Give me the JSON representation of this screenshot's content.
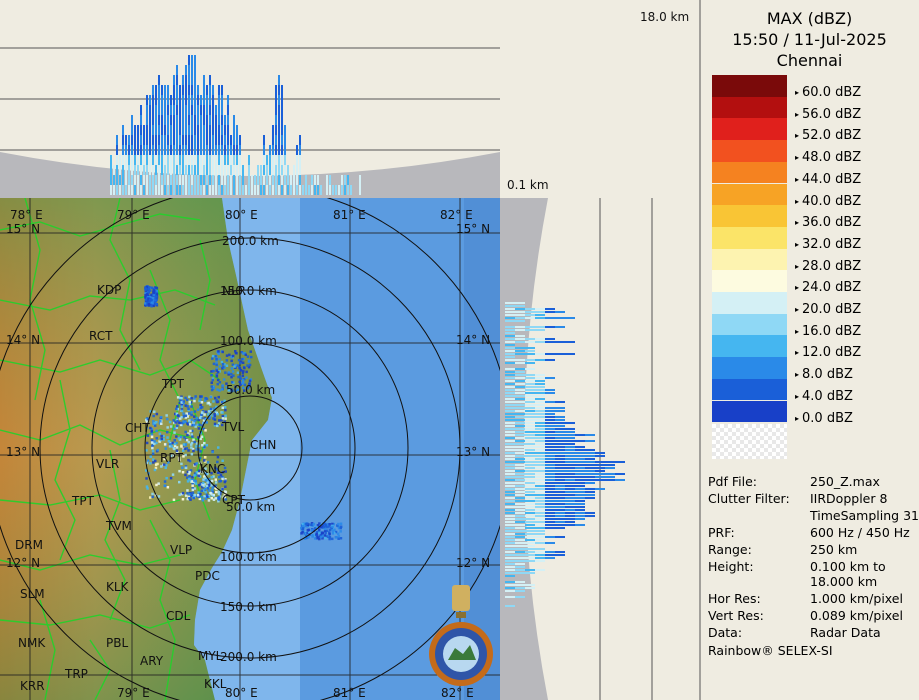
{
  "header": {
    "product": "MAX (dBZ)",
    "datetime": "15:50 / 11-Jul-2025",
    "station": "Chennai"
  },
  "profile_labels": {
    "top_height": "18.0 km",
    "side_height": "0.1 km"
  },
  "legend": [
    {
      "label": "60.0 dBZ",
      "color": "#7a0a0a"
    },
    {
      "label": "56.0 dBZ",
      "color": "#b30f0f"
    },
    {
      "label": "52.0 dBZ",
      "color": "#e0201c"
    },
    {
      "label": "48.0 dBZ",
      "color": "#f2511f"
    },
    {
      "label": "44.0 dBZ",
      "color": "#f58220"
    },
    {
      "label": "40.0 dBZ",
      "color": "#f7a325"
    },
    {
      "label": "36.0 dBZ",
      "color": "#f9c535"
    },
    {
      "label": "32.0 dBZ",
      "color": "#fbe468"
    },
    {
      "label": "28.0 dBZ",
      "color": "#fdf3b0"
    },
    {
      "label": "24.0 dBZ",
      "color": "#fdfbe0"
    },
    {
      "label": "20.0 dBZ",
      "color": "#d4f0f5"
    },
    {
      "label": "16.0 dBZ",
      "color": "#8fd8f5"
    },
    {
      "label": "12.0 dBZ",
      "color": "#45b6f0"
    },
    {
      "label": "8.0 dBZ",
      "color": "#2a8ae8"
    },
    {
      "label": "4.0 dBZ",
      "color": "#1a5fd8"
    },
    {
      "label": "0.0 dBZ",
      "color": "#1840c8"
    }
  ],
  "metadata": [
    {
      "key": "Pdf File:",
      "value": "250_Z.max"
    },
    {
      "key": "Clutter Filter:",
      "value": "IIRDoppler 8"
    },
    {
      "key": "",
      "value": "TimeSampling 31"
    },
    {
      "key": "PRF:",
      "value": "600 Hz / 450 Hz"
    },
    {
      "key": "Range:",
      "value": "250 km"
    },
    {
      "key": "Height:",
      "value": "0.100 km to 18.000 km"
    },
    {
      "key": "Hor Res:",
      "value": "1.000 km/pixel"
    },
    {
      "key": "Vert Res:",
      "value": "0.089 km/pixel"
    },
    {
      "key": "Data:",
      "value": "Radar Data"
    }
  ],
  "credit": "Rainbow® SELEX-SI",
  "map": {
    "lon_top": [
      "78° E",
      "79° E",
      "80° E",
      "81° E",
      "82° E"
    ],
    "lon_bottom": [
      "79° E",
      "80° E",
      "81° E",
      "82° E"
    ],
    "lat_left": [
      "15° N",
      "14° N",
      "13° N",
      "12° N"
    ],
    "lat_right": [
      "15° N",
      "14° N",
      "13° N",
      "12° N"
    ],
    "ranges": [
      "50.0 km",
      "100.0 km",
      "150.0 km",
      "200.0 km",
      "50.0 km",
      "100.0 km",
      "150.0 km",
      "200.0 km"
    ],
    "cities": [
      "KDP",
      "NLR",
      "RCT",
      "TPT",
      "CHT",
      "TVL",
      "CHN",
      "RPT",
      "KNC",
      "VLR",
      "CPT",
      "TPT",
      "TVM",
      "DRM",
      "VLP",
      "PDC",
      "KLK",
      "SLM",
      "CDL",
      "NMK",
      "PBL",
      "ARY",
      "MYL",
      "KKL",
      "TRP",
      "KRR"
    ]
  }
}
